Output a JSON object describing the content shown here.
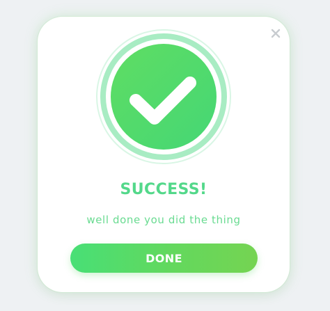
{
  "dialog": {
    "title": "SUCCESS!",
    "message": "well done you did the thing",
    "primary_button_label": "DONE",
    "close_icon": "close-icon",
    "status_icon": "check-icon"
  },
  "colors": {
    "page_background": "#eef1f3",
    "dialog_background": "#ffffff",
    "accent_green": "#53d88a",
    "accent_green_light": "#78e2a1",
    "button_gradient_start": "#48df76",
    "button_gradient_end": "#75d452"
  }
}
